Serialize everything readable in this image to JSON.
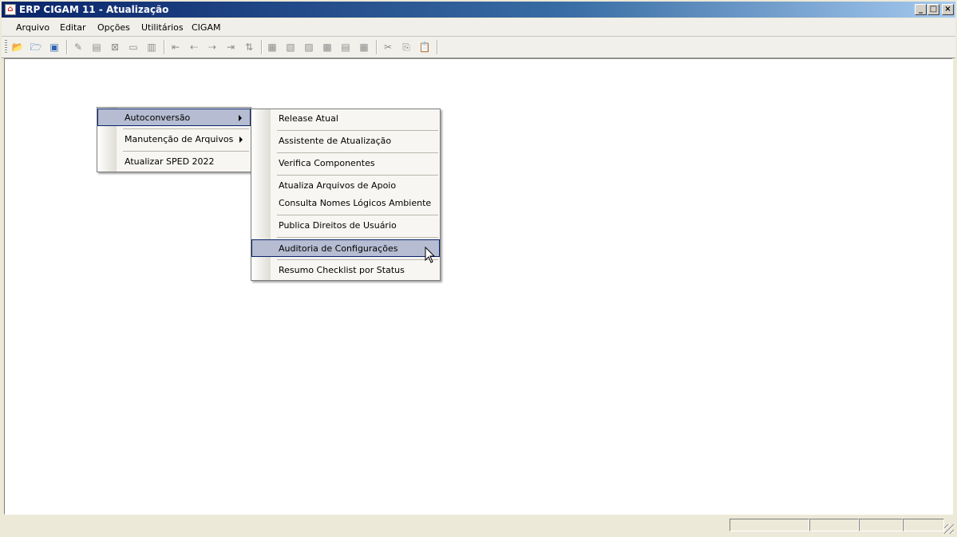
{
  "window": {
    "title": "ERP CIGAM 11 - Atualização",
    "icon": "app-icon",
    "controls": [
      "minimize-icon",
      "maximize-icon",
      "close-icon"
    ]
  },
  "menubar": {
    "items": [
      "Arquivo",
      "Editar",
      "Opções",
      "Utilitários",
      "CIGAM"
    ]
  },
  "toolbar": {
    "buttons": [
      "open-icon",
      "open-folder-icon",
      "window-icon",
      "edit-icon",
      "new-record-icon",
      "delete-icon",
      "page-icon",
      "list-icon",
      "first-icon",
      "previous-icon",
      "next-icon",
      "last-icon",
      "sort-icon",
      "grid-icon",
      "tree-icon",
      "view-icon",
      "report-icon",
      "filter-icon",
      "calc-icon",
      "cut-icon",
      "copy-icon",
      "paste-icon"
    ]
  },
  "menu_level1": {
    "items": [
      {
        "label": "Autoconversão",
        "submenu": true,
        "highlighted": true
      },
      {
        "label": "Manutenção de Arquivos",
        "submenu": true
      },
      {
        "label": "Atualizar SPED 2022",
        "submenu": false
      }
    ]
  },
  "menu_level2": {
    "items": [
      {
        "label": "Release Atual"
      },
      {
        "label": "Assistente de Atualização"
      },
      {
        "label": "Verifica Componentes"
      },
      {
        "label": "Atualiza Arquivos de Apoio"
      },
      {
        "label": "Consulta Nomes Lógicos Ambiente"
      },
      {
        "label": "Publica Direitos de Usuário"
      },
      {
        "label": "Auditoria de Configurações",
        "highlighted": true
      },
      {
        "label": "Resumo Checklist por Status"
      }
    ]
  },
  "colors": {
    "title_gradient_start": "#0a246a",
    "menu_highlight": "#b6bdd2"
  }
}
